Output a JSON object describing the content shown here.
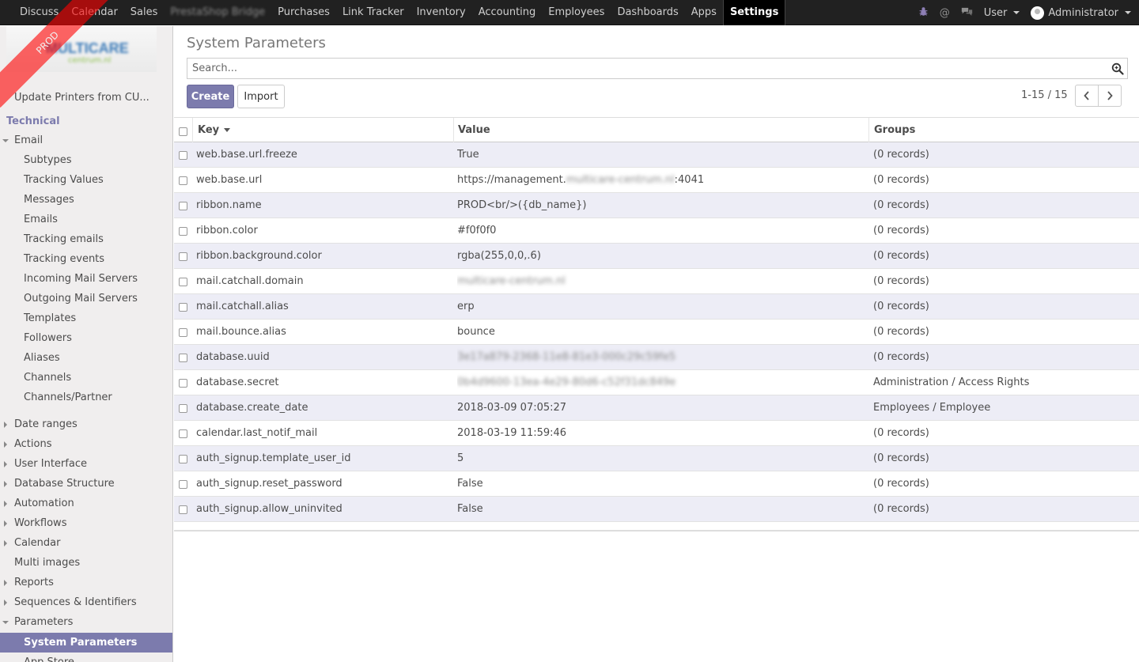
{
  "ribbon": {
    "text": "PROD",
    "background_color": "rgba(255,0,0,.6)",
    "text_color": "#f0f0f0"
  },
  "topnav": {
    "menus": [
      "Discuss",
      "Calendar",
      "Sales",
      "PrestaShop Bridge",
      "Purchases",
      "Link Tracker",
      "Inventory",
      "Accounting",
      "Employees",
      "Dashboards",
      "Apps",
      "Settings"
    ],
    "active": "Settings",
    "user_menu": "User",
    "admin_menu": "Administrator"
  },
  "sidebar": {
    "logo_text": "MULTICARE",
    "logo_sub": "centrum.nl",
    "update_printers": "Update Printers from CU...",
    "category": "Technical",
    "email_label": "Email",
    "email_items": [
      "Subtypes",
      "Tracking Values",
      "Messages",
      "Emails",
      "Tracking emails",
      "Tracking events",
      "Incoming Mail Servers",
      "Outgoing Mail Servers",
      "Templates",
      "Followers",
      "Aliases",
      "Channels",
      "Channels/Partner"
    ],
    "sections": [
      "Date ranges",
      "Actions",
      "User Interface",
      "Database Structure",
      "Automation",
      "Workflows",
      "Calendar",
      "Multi images",
      "Reports",
      "Sequences & Identifiers",
      "Parameters"
    ],
    "active_item": "System Parameters",
    "next_item": "App Store"
  },
  "main": {
    "title": "System Parameters",
    "search_placeholder": "Search...",
    "create_label": "Create",
    "import_label": "Import",
    "pager": "1-15 / 15"
  },
  "table": {
    "headers": {
      "key": "Key",
      "value": "Value",
      "groups": "Groups"
    },
    "rows": [
      {
        "key": "web.base.url.freeze",
        "value": "True",
        "groups": "(0 records)"
      },
      {
        "key": "web.base.url",
        "value_prefix": "https://management.",
        "value_blurred": "multicare-centrum.nl",
        "value_suffix": ":4041",
        "groups": "(0 records)"
      },
      {
        "key": "ribbon.name",
        "value": "PROD<br/>({db_name})",
        "groups": "(0 records)"
      },
      {
        "key": "ribbon.color",
        "value": "#f0f0f0",
        "groups": "(0 records)"
      },
      {
        "key": "ribbon.background.color",
        "value": "rgba(255,0,0,.6)",
        "groups": "(0 records)"
      },
      {
        "key": "mail.catchall.domain",
        "value_blurred": "multicare-centrum.nl",
        "groups": "(0 records)"
      },
      {
        "key": "mail.catchall.alias",
        "value": "erp",
        "groups": "(0 records)"
      },
      {
        "key": "mail.bounce.alias",
        "value": "bounce",
        "groups": "(0 records)"
      },
      {
        "key": "database.uuid",
        "value_blurred": "3e17a879-2368-11e8-81e3-000c29c59fe5",
        "groups": "(0 records)"
      },
      {
        "key": "database.secret",
        "value_blurred": "0b4d9600-13ea-4e29-80d6-c52f31dc849e",
        "groups": "Administration / Access Rights"
      },
      {
        "key": "database.create_date",
        "value": "2018-03-09 07:05:27",
        "groups": "Employees / Employee"
      },
      {
        "key": "calendar.last_notif_mail",
        "value": "2018-03-19 11:59:46",
        "groups": "(0 records)"
      },
      {
        "key": "auth_signup.template_user_id",
        "value": "5",
        "groups": "(0 records)"
      },
      {
        "key": "auth_signup.reset_password",
        "value": "False",
        "groups": "(0 records)"
      },
      {
        "key": "auth_signup.allow_uninvited",
        "value": "False",
        "groups": "(0 records)"
      }
    ]
  },
  "colors": {
    "brand": "#7c7bad",
    "topbar": "#212121",
    "row_alt": "#ededf6",
    "sidebar_bg": "#f0eeee"
  }
}
